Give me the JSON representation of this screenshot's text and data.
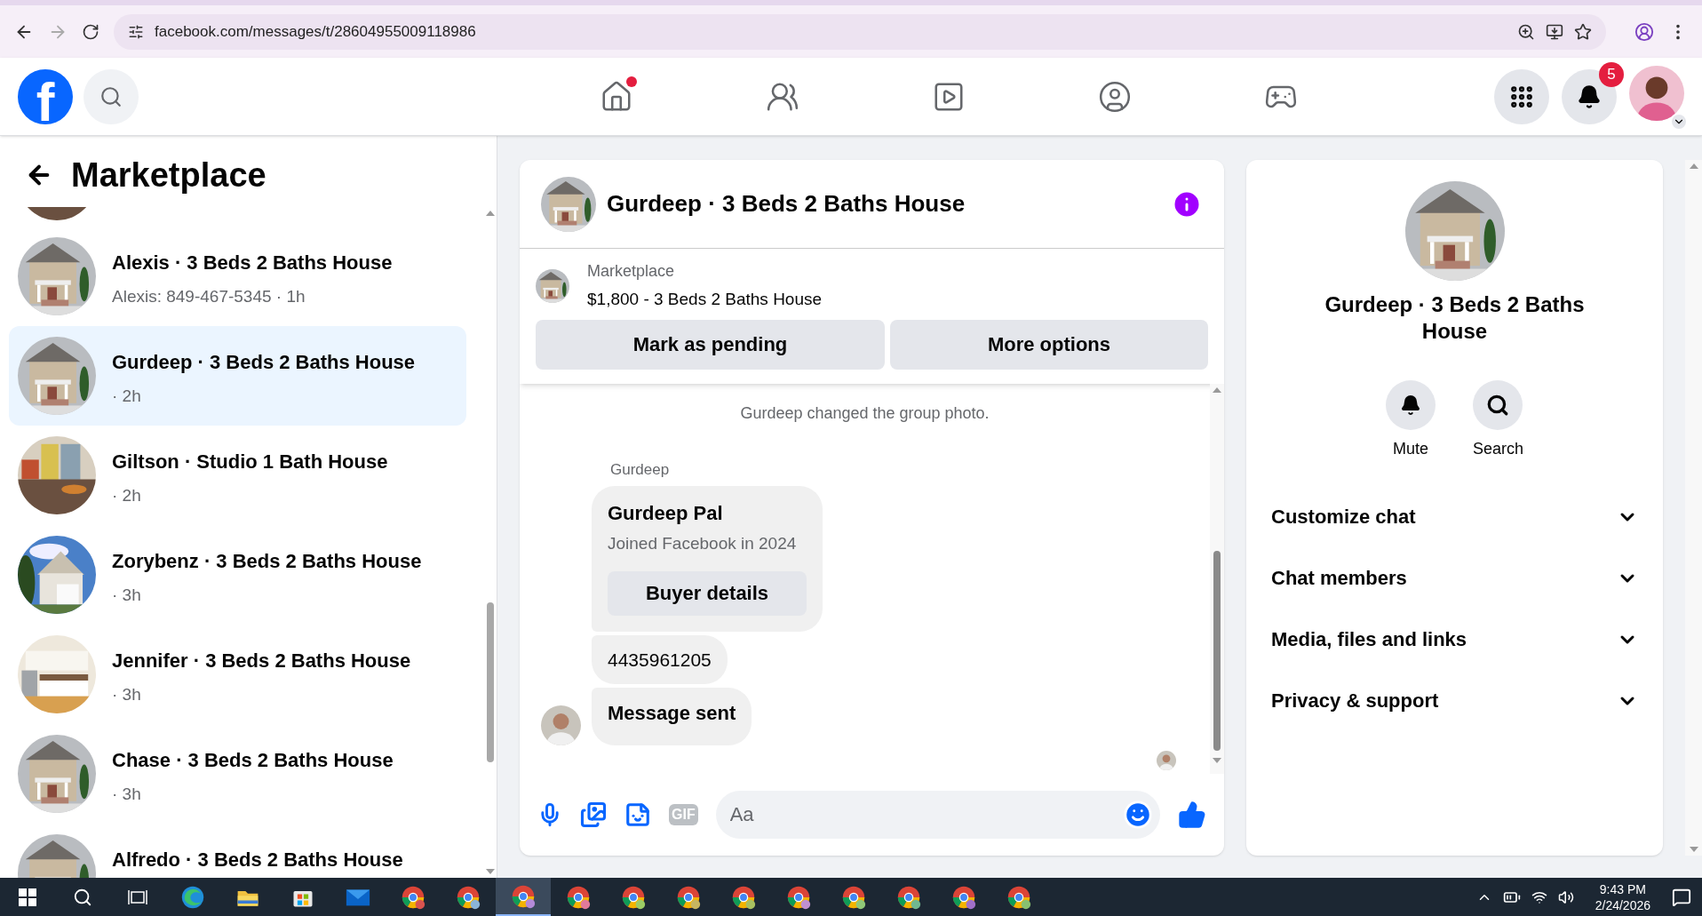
{
  "browser": {
    "url": "facebook.com/messages/t/28604955009118986",
    "forward_disabled": true
  },
  "header": {
    "logo": "f",
    "nav": [
      {
        "kind": "home",
        "dot": true
      },
      {
        "kind": "friends",
        "dot": false
      },
      {
        "kind": "video",
        "dot": false
      },
      {
        "kind": "groups",
        "dot": false
      },
      {
        "kind": "gaming",
        "dot": false
      }
    ],
    "notifications_count": "5"
  },
  "sidebar": {
    "title": "Marketplace",
    "conversations": [
      {
        "title": "Alexis · 3 Beds 2 Baths House",
        "subtitle": "Alexis: 849-467-5345 · 1h",
        "selected": false
      },
      {
        "title": "Gurdeep · 3 Beds 2 Baths House",
        "subtitle": "· 2h",
        "selected": true
      },
      {
        "title": "Giltson · Studio 1 Bath House",
        "subtitle": "· 2h",
        "selected": false
      },
      {
        "title": "Zorybenz · 3 Beds 2 Baths House",
        "subtitle": "· 3h",
        "selected": false
      },
      {
        "title": "Jennifer · 3 Beds 2 Baths House",
        "subtitle": "· 3h",
        "selected": false
      },
      {
        "title": "Chase · 3 Beds 2 Baths House",
        "subtitle": "· 3h",
        "selected": false
      },
      {
        "title": "Alfredo · 3 Beds 2 Baths House",
        "selected": false
      }
    ]
  },
  "chat": {
    "title": "Gurdeep · 3 Beds 2 Baths House",
    "listing": {
      "label": "Marketplace",
      "name": "$1,800 - 3 Beds 2 Baths House"
    },
    "buttons": [
      "Mark as pending",
      "More options"
    ],
    "event": "Gurdeep changed the group photo.",
    "sender": "Gurdeep",
    "card": {
      "name": "Gurdeep Pal",
      "note": "Joined Facebook in 2024",
      "button": "Buyer details"
    },
    "messages": [
      {
        "text": "4435961205",
        "emphasized": false
      },
      {
        "text": "Message sent",
        "emphasized": true
      }
    ],
    "composer": {
      "placeholder": "Aa",
      "gif": "GIF"
    }
  },
  "details": {
    "title": "Gurdeep · 3 Beds 2 Baths House",
    "actions": [
      {
        "kind": "mute",
        "label": "Mute"
      },
      {
        "kind": "search",
        "label": "Search"
      }
    ],
    "sections": [
      {
        "label": "Customize chat",
        "expanded": false
      },
      {
        "label": "Chat members",
        "expanded": false
      },
      {
        "label": "Media, files and links",
        "expanded": false
      },
      {
        "label": "Privacy & support",
        "expanded": false
      }
    ]
  },
  "taskbar": {
    "apps": [
      {
        "kind": "start",
        "selected": false
      },
      {
        "kind": "search",
        "selected": false
      },
      {
        "kind": "taskview",
        "selected": false
      },
      {
        "kind": "edge",
        "selected": false
      },
      {
        "kind": "explorer",
        "selected": false
      },
      {
        "kind": "store",
        "selected": false
      },
      {
        "kind": "mail",
        "selected": false
      },
      {
        "kind": "chrome",
        "color": "#d9534f",
        "selected": false
      },
      {
        "kind": "chrome",
        "color": "#8ab4d8",
        "selected": false
      },
      {
        "kind": "chrome",
        "color": "#b48ad8",
        "selected": true
      },
      {
        "kind": "chrome",
        "color": "#e07a9a",
        "selected": false
      },
      {
        "kind": "chrome",
        "color": "#9ccc65",
        "selected": false
      },
      {
        "kind": "chrome",
        "color": "#c8b560",
        "selected": false
      },
      {
        "kind": "chrome",
        "color": "#a8c060",
        "selected": false
      },
      {
        "kind": "chrome",
        "color": "#c090d0",
        "selected": false
      },
      {
        "kind": "chrome",
        "color": "#90c878",
        "selected": false
      },
      {
        "kind": "chrome",
        "color": "#70b890",
        "selected": false
      },
      {
        "kind": "chrome",
        "color": "#a070c8",
        "selected": false
      },
      {
        "kind": "chrome",
        "color": "#88c070",
        "selected": false
      }
    ],
    "time": "9:43 PM",
    "date": "2/24/2026"
  }
}
